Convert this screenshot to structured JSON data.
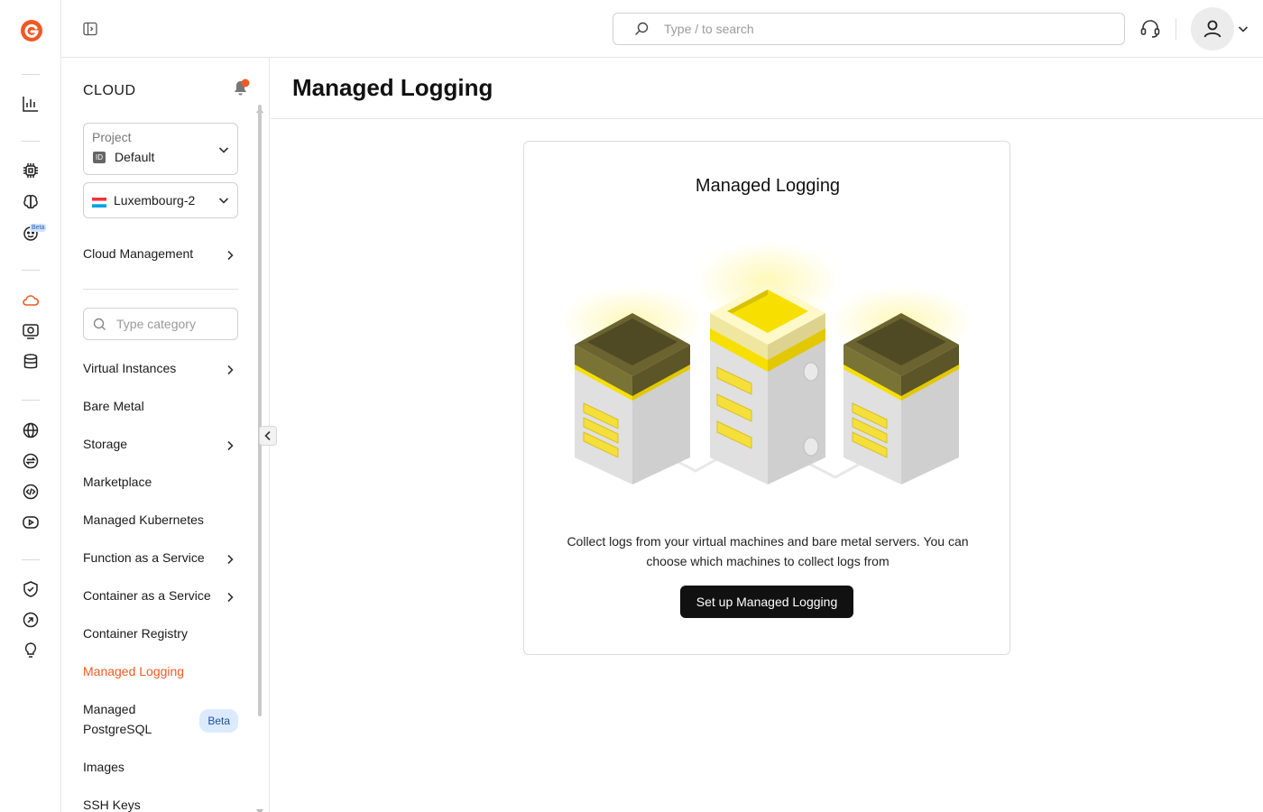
{
  "topbar": {
    "search_placeholder": "Type / to search"
  },
  "rail": {
    "beta_badge": "Beta",
    "icons": [
      "statistics-icon",
      "chip-icon",
      "brain-icon",
      "ai-assistant-icon",
      "cloud-icon",
      "server-icon",
      "database-icon",
      "globe-icon",
      "network-exchange-icon",
      "code-icon",
      "streaming-icon",
      "shield-icon",
      "hand-icon",
      "lightbulb-icon"
    ]
  },
  "sidebar": {
    "title": "CLOUD",
    "project_label": "Project",
    "project_id_tag": "ID",
    "project_value": "Default",
    "region_value": "Luxembourg-2",
    "cloud_management": "Cloud Management",
    "category_placeholder": "Type category",
    "items": [
      {
        "label": "Virtual Instances",
        "has_chevron": true
      },
      {
        "label": "Bare Metal",
        "has_chevron": false
      },
      {
        "label": "Storage",
        "has_chevron": true
      },
      {
        "label": "Marketplace",
        "has_chevron": false
      },
      {
        "label": "Managed Kubernetes",
        "has_chevron": false
      },
      {
        "label": "Function as a Service",
        "has_chevron": true
      },
      {
        "label": "Container as a Service",
        "has_chevron": true
      },
      {
        "label": "Container Registry",
        "has_chevron": false
      },
      {
        "label": "Managed Logging",
        "has_chevron": false,
        "active": true
      },
      {
        "label": "Managed PostgreSQL",
        "has_chevron": false,
        "badge": "Beta"
      },
      {
        "label": "Images",
        "has_chevron": false
      },
      {
        "label": "SSH Keys",
        "has_chevron": false
      }
    ]
  },
  "main": {
    "page_title": "Managed Logging",
    "card_title": "Managed Logging",
    "description": "Collect logs from your virtual machines and bare metal servers. You can choose which machines to collect logs from",
    "cta_label": "Set up Managed Logging"
  },
  "colors": {
    "accent": "#ee5a24",
    "cta_bg": "#111111",
    "beta_bg": "#dbeafe",
    "server_yellow": "#f7e000",
    "server_olive": "#6b6430"
  }
}
